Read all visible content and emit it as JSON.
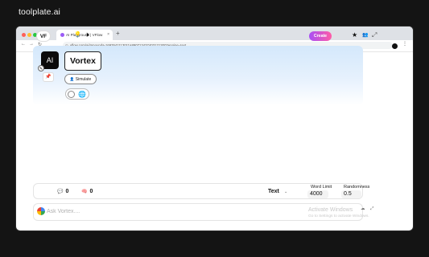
{
  "page": {
    "brand": "toolplate.ai"
  },
  "browser": {
    "tab_title": "AI Playground | VFlow",
    "tab_close": "×",
    "new_tab": "+",
    "url": "vflow.com/ai/mpounda-1697641113011a890713437403121300?engine=text",
    "nav_icons": [
      "back-icon",
      "forward-icon",
      "reload-icon"
    ],
    "nav_glyphs": [
      "←",
      "→",
      "↻"
    ],
    "traffic_lights": [
      "#ff5f57",
      "#febc2e",
      "#28c840"
    ]
  },
  "header": {
    "logo_text": "VF",
    "icons": [
      "bulb-icon",
      "play-icon"
    ],
    "icon_glyphs": [
      "💡",
      "⏵"
    ],
    "create_label": "Create",
    "right_icons": [
      "star-icon",
      "user-settings-icon",
      "expand-icon"
    ],
    "right_glyphs": [
      "★",
      "👥",
      "⤢"
    ]
  },
  "agent": {
    "avatar_text": "AI",
    "name": "Vortex",
    "simulate_label": "Simulate",
    "simulate_glyph": "👤"
  },
  "stats": {
    "comments_count": "0",
    "comments_glyph": "💬",
    "brain_count": "0",
    "brain_glyph": "🧠"
  },
  "controls": {
    "mode": "Text",
    "mode_caret": "⌄",
    "word_limit_label": "Word Limit",
    "word_limit_value": "4000",
    "randomness_label": "Randomness",
    "randomness_value": "0.5"
  },
  "ask": {
    "placeholder": "Ask Vortex...."
  },
  "overlay": {
    "watermark_title": "Activate Windows",
    "watermark_sub": "Go to Settings to activate Windows."
  },
  "colors": {
    "create_gradient_start": "#a84ff5",
    "create_gradient_end": "#ff5ca7",
    "hero_top": "#d4e8fb",
    "page_bg": "#141414"
  }
}
